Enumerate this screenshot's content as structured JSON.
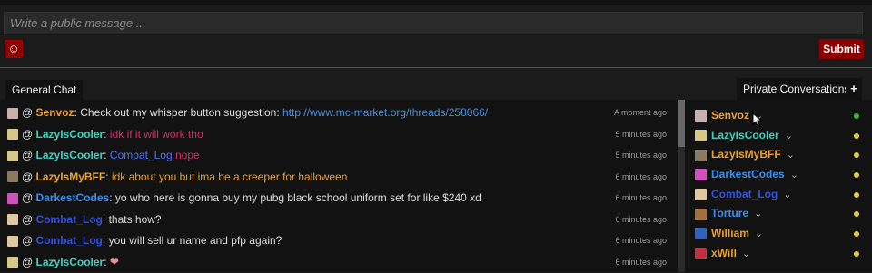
{
  "composer": {
    "placeholder": "Write a public message...",
    "smiley_glyph": "☺",
    "submit_label": "Submit"
  },
  "tabs": {
    "general": "General Chat",
    "private": "Private Conversations",
    "add": "+"
  },
  "messages": [
    {
      "at": "@",
      "user": "Senvoz",
      "user_color": "#e8a030",
      "sep": ":",
      "text": "Check out my whisper button suggestion:",
      "link": "http://www.mc-market.org/threads/258066/",
      "text_color": "#dddddd",
      "time": "A moment ago",
      "avatar_color": "#c9b0b0"
    },
    {
      "at": "@",
      "user": "LazyIsCooler",
      "user_color": "#3fd0c0",
      "sep": ":",
      "text": "idk if it will work tho",
      "text_color": "#d0306a",
      "time": "5 minutes ago",
      "avatar_color": "#d8c888"
    },
    {
      "at": "@",
      "user": "LazyIsCooler",
      "user_color": "#3fd0c0",
      "sep": ":",
      "mention": "Combat_Log",
      "mention_color": "#4a70ff",
      "text": "nope",
      "text_color": "#d0306a",
      "time": "5 minutes ago",
      "avatar_color": "#d8c888"
    },
    {
      "at": "@",
      "user": "LazyIsMyBFF",
      "user_color": "#e8a030",
      "sep": ":",
      "text": "idk about you but ima be a creeper for halloween",
      "text_color": "#e8a030",
      "time": "6 minutes ago",
      "avatar_color": "#8a7a60"
    },
    {
      "at": "@",
      "user": "DarkestCodes",
      "user_color": "#3a8ef0",
      "sep": ":",
      "text": "yo who here is gonna buy my pubg black school uniform set for like $240 xd",
      "text_color": "#dddddd",
      "time": "6 minutes ago",
      "avatar_color": "#d050c0"
    },
    {
      "at": "@",
      "user": "Combat_Log",
      "user_color": "#3050e0",
      "sep": ":",
      "text": "thats how?",
      "text_color": "#dddddd",
      "time": "6 minutes ago",
      "avatar_color": "#e0c8a0"
    },
    {
      "at": "@",
      "user": "Combat_Log",
      "user_color": "#3050e0",
      "sep": ":",
      "text": "you will sell ur name and pfp again?",
      "text_color": "#dddddd",
      "time": "6 minutes ago",
      "avatar_color": "#e0c8a0"
    },
    {
      "at": "@",
      "user": "LazyIsCooler",
      "user_color": "#3fd0c0",
      "sep": ":",
      "text": "❤",
      "text_color": "#e88a9a",
      "time": "6 minutes ago",
      "avatar_color": "#d8c888"
    }
  ],
  "users": [
    {
      "name": "Senvoz",
      "color": "#e8a030",
      "chevron": "⌄",
      "status": "#3ab83a",
      "avatar_color": "#c9b0b0"
    },
    {
      "name": "LazyIsCooler",
      "color": "#3fd0c0",
      "chevron": "⌄",
      "status": "#e0d040",
      "avatar_color": "#d8c888"
    },
    {
      "name": "LazyIsMyBFF",
      "color": "#e8a030",
      "chevron": "⌄",
      "status": "#e0d040",
      "avatar_color": "#8a7a60"
    },
    {
      "name": "DarkestCodes",
      "color": "#3a8ef0",
      "chevron": "⌄",
      "status": "#e0d040",
      "avatar_color": "#d050c0"
    },
    {
      "name": "Combat_Log",
      "color": "#3050e0",
      "chevron": "⌄",
      "status": "#e0d040",
      "avatar_color": "#e0c8a0"
    },
    {
      "name": "Torture",
      "color": "#3a8ef0",
      "chevron": "⌄",
      "status": "#e0d040",
      "avatar_color": "#a07040"
    },
    {
      "name": "William",
      "color": "#e8a030",
      "chevron": "⌄",
      "status": "#e0d040",
      "avatar_color": "#3060c0"
    },
    {
      "name": "xWill",
      "color": "#e8a030",
      "chevron": "⌄",
      "status": "#e0d040",
      "avatar_color": "#c03040"
    }
  ]
}
